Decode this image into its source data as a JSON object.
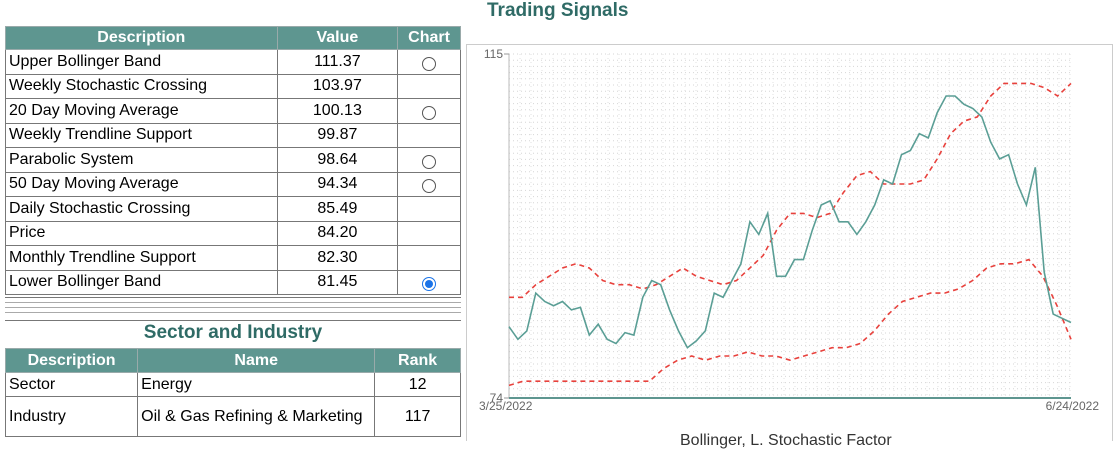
{
  "signals": {
    "headers": {
      "description": "Description",
      "value": "Value",
      "chart": "Chart"
    },
    "rows": [
      {
        "label": "Upper Bollinger Band",
        "value": "111.37",
        "radio": "off"
      },
      {
        "label": "Weekly Stochastic Crossing",
        "value": "103.97",
        "radio": "none"
      },
      {
        "label": "20 Day Moving Average",
        "value": "100.13",
        "radio": "off"
      },
      {
        "label": "Weekly Trendline Support",
        "value": "99.87",
        "radio": "none"
      },
      {
        "label": "Parabolic System",
        "value": "98.64",
        "radio": "off"
      },
      {
        "label": "50 Day Moving Average",
        "value": "94.34",
        "radio": "off"
      },
      {
        "label": "Daily Stochastic Crossing",
        "value": "85.49",
        "radio": "none"
      },
      {
        "label": "Price",
        "value": "84.20",
        "radio": "none"
      },
      {
        "label": "Monthly Trendline Support",
        "value": "82.30",
        "radio": "none"
      },
      {
        "label": "Lower Bollinger Band",
        "value": "81.45",
        "radio": "on"
      }
    ]
  },
  "sector": {
    "title": "Sector and Industry",
    "headers": {
      "description": "Description",
      "name": "Name",
      "rank": "Rank"
    },
    "rows": [
      {
        "description": "Sector",
        "name": "Energy",
        "rank": "12"
      },
      {
        "description": "Industry",
        "name": "Oil & Gas Refining & Marketing",
        "rank": "117"
      }
    ]
  },
  "chart_title": "Trading Signals",
  "chart_caption": "Bollinger, L. Stochastic Factor",
  "chart_data": {
    "type": "line",
    "ylim": [
      74,
      115
    ],
    "y_ticks": [
      "115",
      "74"
    ],
    "x_ticks": [
      "3/25/2022",
      "6/24/2022"
    ],
    "grid": true,
    "colors": {
      "price": "#5a9e95",
      "bands": "#e8413c"
    },
    "series": [
      {
        "values": [
          82.5,
          81.0,
          82.0,
          86.5,
          85.5,
          85.0,
          85.5,
          84.5,
          84.8,
          81.5,
          82.8,
          81.0,
          80.5,
          81.8,
          81.5,
          86.0,
          88.0,
          87.5,
          84.5,
          82.0,
          80.0,
          80.8,
          82.0,
          86.5,
          86.0,
          88.0,
          90.0,
          95.0,
          93.5,
          96.0,
          88.5,
          88.5,
          90.5,
          90.5,
          94.0,
          97.0,
          97.5,
          95.0,
          95.0,
          93.5,
          95.0,
          97.0,
          100.0,
          99.5,
          103.0,
          103.5,
          105.5,
          105.0,
          108.0,
          110.0,
          110.0,
          109.0,
          108.5,
          107.5,
          104.5,
          102.5,
          103.0,
          99.5,
          97.0,
          101.5,
          89.0,
          84.0,
          83.5,
          83.0
        ]
      },
      {
        "values": [
          86.0,
          86.0,
          87.5,
          88.5,
          89.5,
          90.0,
          89.5,
          88.0,
          87.5,
          87.5,
          87.0,
          87.5,
          88.5,
          89.5,
          88.5,
          88.0,
          87.5,
          88.0,
          89.5,
          91.0,
          94.0,
          96.0,
          96.0,
          95.5,
          96.0,
          98.5,
          100.5,
          101.0,
          99.5,
          99.5,
          99.5,
          100.0,
          102.5,
          105.5,
          107.0,
          107.5,
          110.0,
          111.5,
          111.5,
          111.5,
          111.0,
          110.0,
          111.5
        ]
      },
      {
        "values": [
          75.5,
          76.0,
          76.0,
          76.0,
          76.0,
          76.0,
          76.0,
          76.0,
          76.0,
          76.0,
          76.0,
          77.5,
          78.5,
          79.0,
          78.5,
          79.0,
          79.0,
          79.5,
          79.0,
          79.0,
          78.5,
          79.0,
          79.5,
          80.0,
          80.0,
          80.5,
          82.0,
          84.0,
          85.5,
          86.0,
          86.5,
          86.5,
          87.0,
          88.0,
          89.5,
          90.0,
          90.0,
          90.5,
          88.5,
          85.0,
          81.0
        ]
      }
    ]
  }
}
